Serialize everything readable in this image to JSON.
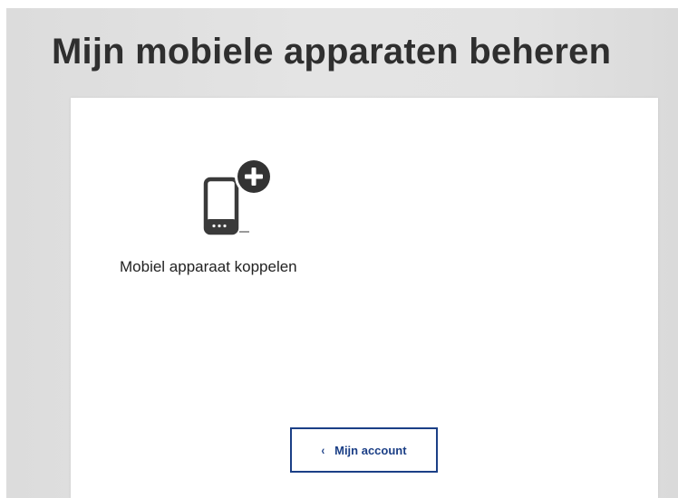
{
  "header": {
    "title": "Mijn mobiele apparaten beheren"
  },
  "actions": {
    "link_device_label": "Mobiel apparaat koppelen",
    "link_device_icon": "phone-plus-icon"
  },
  "footer": {
    "back_label": "Mijn account",
    "back_icon": "chevron-left-icon"
  },
  "colors": {
    "accent": "#1b3f86",
    "icon": "#3a3a3a",
    "title": "#2f2f2f"
  }
}
